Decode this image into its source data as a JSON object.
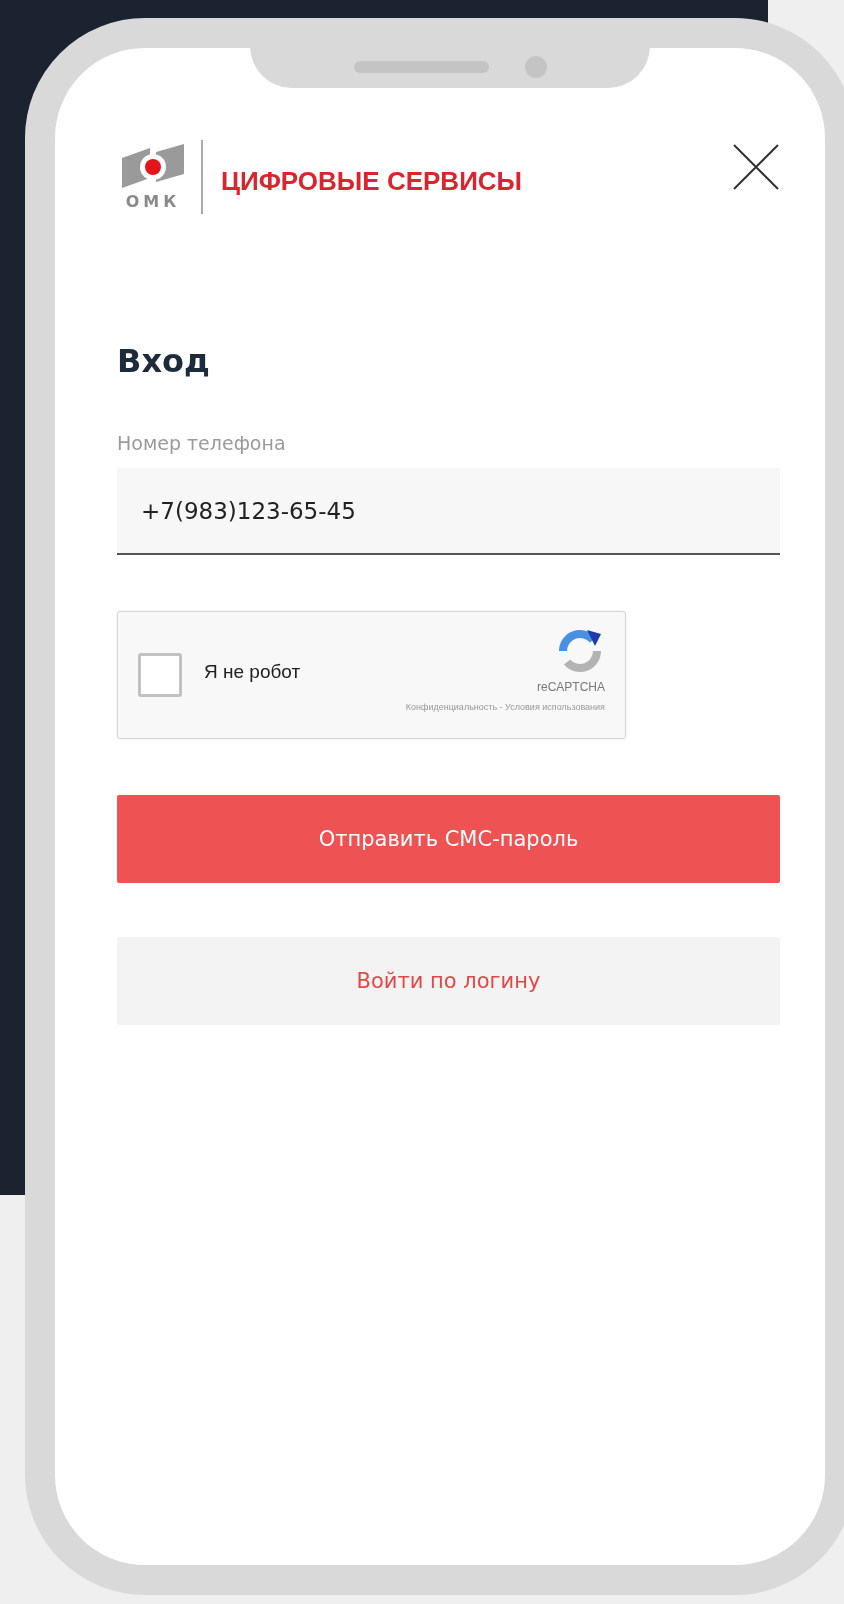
{
  "header": {
    "logo_text": "ОМК",
    "brand": "ЦИФРОВЫЕ СЕРВИСЫ"
  },
  "title": "Вход",
  "phone_field": {
    "label": "Номер телефона",
    "value": "+7(983)123-65-45"
  },
  "captcha": {
    "label": "Я не робот",
    "checked": false,
    "brand": "reCAPTCHA",
    "links": "Конфиденциальность - Условия использования"
  },
  "buttons": [
    {
      "label": "Отправить СМС-пароль",
      "kind": "primary"
    },
    {
      "label": "Войти по логину",
      "kind": "secondary"
    }
  ]
}
